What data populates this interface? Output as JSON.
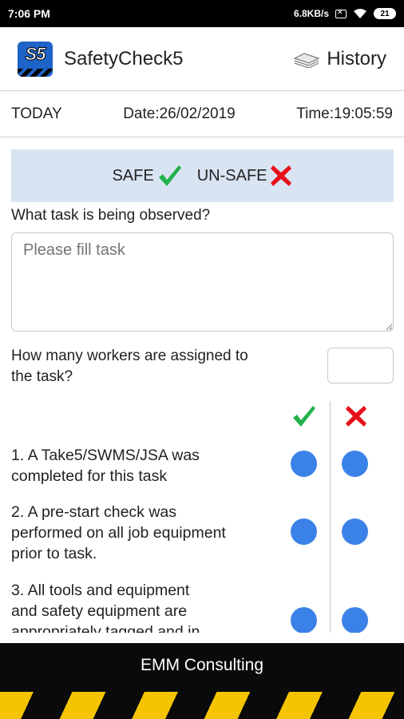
{
  "status_bar": {
    "time": "7:06 PM",
    "net_speed": "6.8KB/s",
    "battery": "21"
  },
  "app_bar": {
    "logo_text": "S5",
    "title": "SafetyCheck5",
    "history_label": "History",
    "brand_color": "#1e63c7"
  },
  "info": {
    "today": "TODAY",
    "date": "Date:26/02/2019",
    "time": "Time:19:05:59"
  },
  "legend": {
    "safe_label": "SAFE",
    "unsafe_label": "UN-SAFE",
    "safe_color": "#22b14c",
    "unsafe_color": "#e8101a"
  },
  "form": {
    "task_question": "What task is being observed?",
    "task_placeholder": "Please fill task",
    "task_value": "",
    "workers_question_line1": "How many workers are assigned to",
    "workers_question_line2": "the task?",
    "workers_value": ""
  },
  "checklist": [
    {
      "line1": "1. A Take5/SWMS/JSA was",
      "line2": "completed for this task",
      "line3": ""
    },
    {
      "line1": "2. A pre-start check was",
      "line2": "performed on all job equipment",
      "line3": "prior to task."
    },
    {
      "line1": "3. All tools and equipment",
      "line2": "and safety equipment are",
      "line3": "appropriately tagged and in"
    }
  ],
  "footer": {
    "company": "EMM Consulting"
  }
}
